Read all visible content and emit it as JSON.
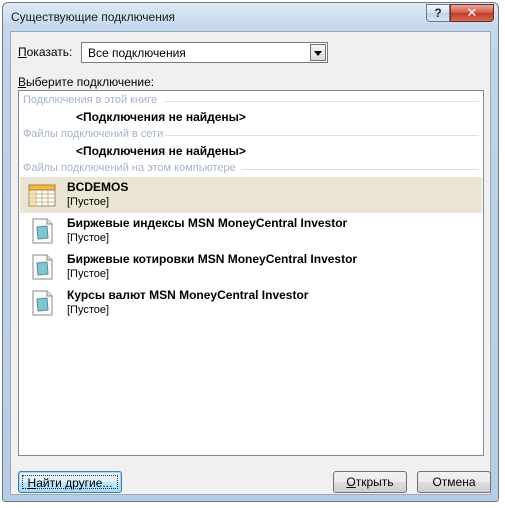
{
  "window": {
    "title": "Существующие подключения",
    "help_glyph": "?",
    "close_glyph": "✕"
  },
  "filter": {
    "label_accel": "П",
    "label_rest": "оказать:",
    "selected": "Все подключения"
  },
  "list_prompt": {
    "accel": "В",
    "rest": "ыберите подключение:"
  },
  "groups": {
    "workbook": {
      "header": "Подключения в этой книге",
      "empty": "<Подключения не найдены>"
    },
    "network": {
      "header": "Файлы подключений в сети",
      "empty": "<Подключения не найдены>"
    },
    "computer": {
      "header": "Файлы подключений на этом компьютере"
    }
  },
  "items": [
    {
      "name": "BCDEMOS",
      "desc": "[Пустое]",
      "icon": "database-table-icon",
      "selected": true
    },
    {
      "name": "Биржевые индексы MSN MoneyCentral Investor",
      "desc": "[Пустое]",
      "icon": "query-file-icon",
      "selected": false
    },
    {
      "name": "Биржевые котировки MSN MoneyCentral Investor",
      "desc": "[Пустое]",
      "icon": "query-file-icon",
      "selected": false
    },
    {
      "name": "Курсы валют MSN MoneyCentral Investor",
      "desc": "[Пустое]",
      "icon": "query-file-icon",
      "selected": false
    }
  ],
  "buttons": {
    "find_accel": "Н",
    "find_rest": "айти другие...",
    "open_accel": "О",
    "open_rest": "ткрыть",
    "cancel": "Отмена"
  },
  "colors": {
    "selection": "#ebe6d4",
    "group_header": "#a5b4c8",
    "close_button": "#c03a2a"
  }
}
